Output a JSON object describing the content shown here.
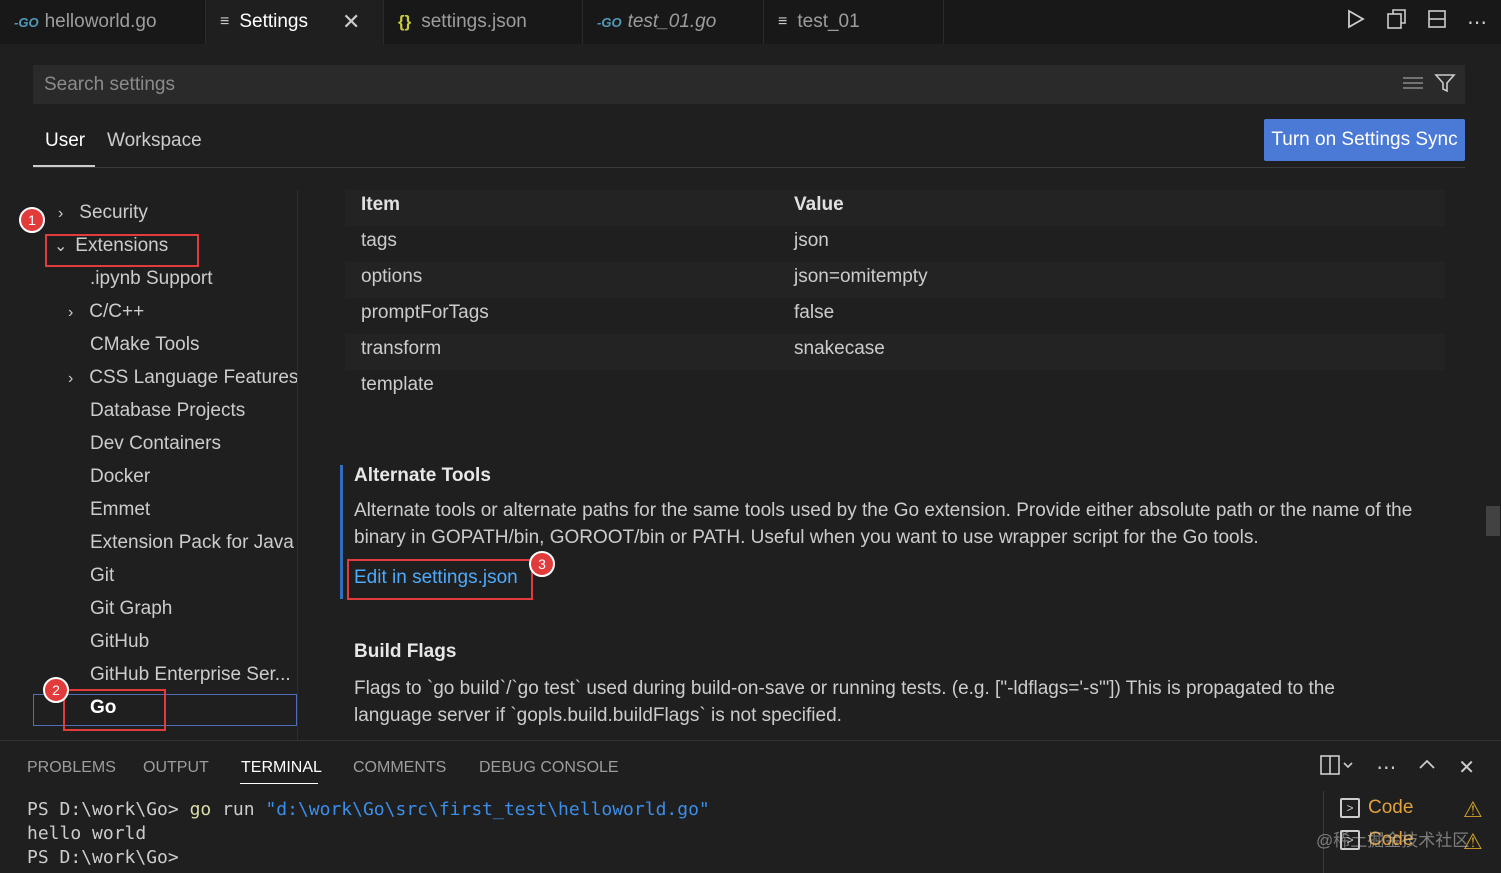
{
  "tabs": [
    {
      "label": "helloworld.go",
      "icon": "go-icon"
    },
    {
      "label": "Settings",
      "icon": "settings-lines-icon",
      "close": "✕"
    },
    {
      "label": "settings.json",
      "icon": "json-braces-icon",
      "icon_glyph": "{}"
    },
    {
      "label": "test_01.go",
      "icon": "go-icon"
    },
    {
      "label": "test_01",
      "icon": "lines-icon"
    }
  ],
  "go_badge": "-GO",
  "search": {
    "placeholder": "Search settings"
  },
  "scope": {
    "user": "User",
    "workspace": "Workspace",
    "sync_button": "Turn on Settings Sync"
  },
  "toc": {
    "items": [
      "Security",
      "Extensions",
      ".ipynb Support",
      "C/C++",
      "CMake Tools",
      "CSS Language Features",
      "Database Projects",
      "Dev Containers",
      "Docker",
      "Emmet",
      "Extension Pack for Java",
      "Git",
      "Git Graph",
      "GitHub",
      "GitHub Enterprise Ser...",
      "Go"
    ]
  },
  "markers": [
    "1",
    "2",
    "3"
  ],
  "table": {
    "headers": [
      "Item",
      "Value"
    ],
    "rows": [
      [
        "tags",
        "json"
      ],
      [
        "options",
        "json=omitempty"
      ],
      [
        "promptForTags",
        "false"
      ],
      [
        "transform",
        "snakecase"
      ],
      [
        "template",
        ""
      ]
    ]
  },
  "alternate_tools": {
    "title": "Alternate Tools",
    "desc1": "Alternate tools or alternate paths for the same tools used by the Go extension. Provide either absolute path or the name of the",
    "desc2": "binary in GOPATH/bin, GOROOT/bin or PATH. Useful when you want to use wrapper script for the Go tools.",
    "link": "Edit in settings.json"
  },
  "build_flags": {
    "title": "Build Flags",
    "desc1": "Flags to `go build`/`go test` used during build-on-save or running tests. (e.g. [\"-ldflags='-s'\"]) This is propagated to the",
    "desc2": "language server if `gopls.build.buildFlags` is not specified."
  },
  "panel": {
    "tabs": [
      "PROBLEMS",
      "OUTPUT",
      "TERMINAL",
      "COMMENTS",
      "DEBUG CONSOLE"
    ],
    "active_tab": "TERMINAL"
  },
  "terminal": {
    "prompt": "PS D:\\work\\Go> ",
    "cmd": "go",
    "run": " run ",
    "path": "\"d:\\work\\Go\\src\\first_test\\helloworld.go\"",
    "output": "hello world",
    "prompt2": "PS D:\\work\\Go>"
  },
  "terminal_list": [
    {
      "label": "Code",
      "icon": "terminal-icon"
    },
    {
      "label": "Code",
      "icon": "terminal-icon"
    }
  ],
  "watermark": "@稀土掘金技术社区",
  "colors": {
    "accent": "#4b7ad6",
    "link": "#4daafc",
    "marker": "#e23b3b",
    "focus_border": "#4e6fb8"
  }
}
